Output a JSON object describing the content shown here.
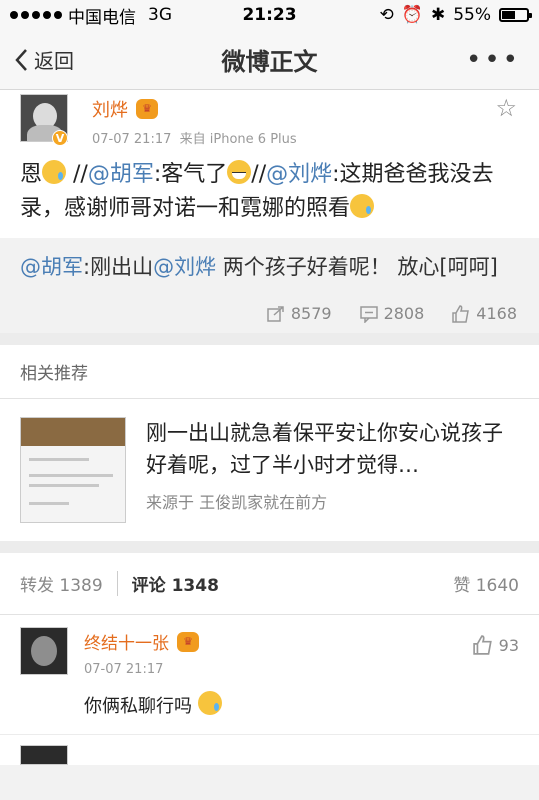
{
  "status_bar": {
    "carrier": "中国电信",
    "network": "3G",
    "time": "21:23",
    "battery": "55%",
    "battery_level": 0.55
  },
  "nav": {
    "back_label": "返回",
    "title": "微博正文",
    "more_label": "•••"
  },
  "post": {
    "author": "刘烨",
    "timestamp": "07-07 21:17",
    "source": "来自 iPhone 6 Plus",
    "text_parts": {
      "p1": "恩",
      "p2": " //",
      "m1": "@胡军",
      "p3": ":客气了",
      "p4": "//",
      "m2": "@刘烨",
      "p5": ":这期爸爸我没去录，感谢师哥对诺一和霓娜的照看"
    }
  },
  "repost": {
    "m1": "@胡军",
    "t1": ":刚出山",
    "m2": "@刘烨",
    "t2": " 两个孩子好着呢！ 放心[呵呵]",
    "reposts": "8579",
    "comments": "2808",
    "likes": "4168"
  },
  "recommend": {
    "header": "相关推荐",
    "title": "刚一出山就急着保平安让你安心说孩子好着呢，过了半小时才觉得…",
    "source": "来源于 王俊凯家就在前方"
  },
  "tabs": {
    "repost_label": "转发 1389",
    "comment_label": "评论 1348",
    "like_label": "赞 1640"
  },
  "comments": [
    {
      "name": "终结十一张",
      "time": "07-07 21:17",
      "text": "你俩私聊行吗",
      "likes": "93"
    }
  ],
  "colors": {
    "accent_orange": "#e46d1e",
    "mention_blue": "#4a7eb5"
  }
}
